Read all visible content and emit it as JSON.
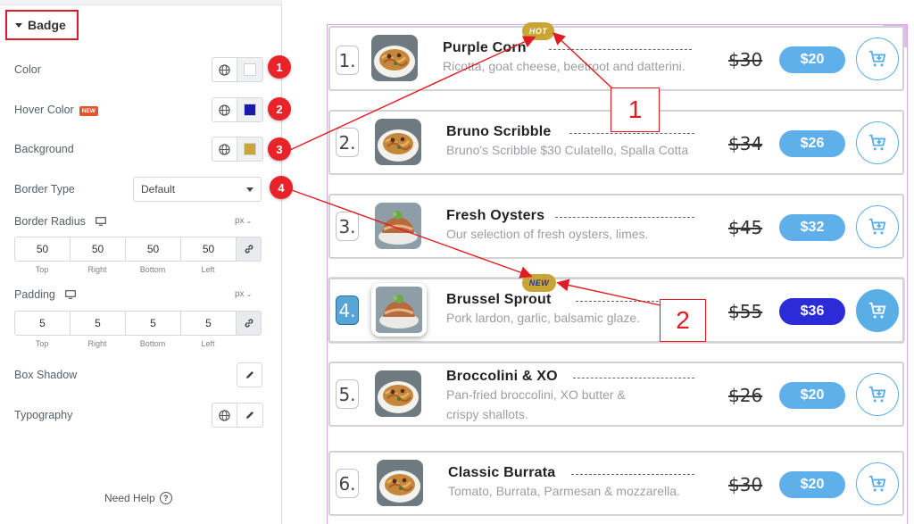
{
  "panel": {
    "section_title": "Badge",
    "controls": {
      "color_label": "Color",
      "hover_color_label": "Hover Color",
      "new_tag": "NEW",
      "background_label": "Background",
      "border_type_label": "Border Type",
      "border_type_value": "Default",
      "border_radius_label": "Border Radius",
      "padding_label": "Padding",
      "box_shadow_label": "Box Shadow",
      "typography_label": "Typography",
      "unit": "px"
    },
    "swatches": {
      "color": "#ffffff",
      "hover_color": "#1a1aa8",
      "background": "#c9a536"
    },
    "border_radius": {
      "top": "50",
      "right": "50",
      "bottom": "50",
      "left": "50"
    },
    "padding": {
      "top": "5",
      "right": "5",
      "bottom": "5",
      "left": "5"
    },
    "dim_labels": {
      "top": "Top",
      "right": "Right",
      "bottom": "Bottom",
      "left": "Left"
    },
    "markers": [
      "1",
      "2",
      "3",
      "4"
    ],
    "need_help": "Need Help",
    "help_glyph": "?"
  },
  "menu": {
    "items": [
      {
        "num": "1.",
        "title": "Purple Corn",
        "desc": "Ricotta, goat cheese, beetroot and datterini.",
        "old_price": "$30",
        "price": "$20"
      },
      {
        "num": "2.",
        "title": "Bruno Scribble",
        "desc": "Bruno's Scribble $30 Culatello, Spalla Cotta",
        "old_price": "$34",
        "price": "$26"
      },
      {
        "num": "3.",
        "title": "Fresh Oysters",
        "desc": "Our selection of fresh oysters, limes.",
        "old_price": "$45",
        "price": "$32"
      },
      {
        "num": "4.",
        "title": "Brussel Sprout",
        "desc": "Pork lardon, garlic, balsamic glaze.",
        "old_price": "$55",
        "price": "$36"
      },
      {
        "num": "5.",
        "title": "Broccolini & XO",
        "desc": "Pan-fried broccolini, XO butter &",
        "desc2": "crispy shallots.",
        "old_price": "$26",
        "price": "$20"
      },
      {
        "num": "6.",
        "title": "Classic Burrata",
        "desc": "Tomato, Burrata, Parmesan & mozzarella.",
        "old_price": "$30",
        "price": "$20"
      }
    ],
    "badges": {
      "hot": "HOT",
      "new": "NEW"
    }
  },
  "callouts": {
    "first": "1",
    "second": "2"
  },
  "colors": {
    "annotation_red": "#e01b22",
    "badge_bg": "#c9a536",
    "price_blue": "#5fb0ea",
    "active_price": "#2b2bd8"
  }
}
